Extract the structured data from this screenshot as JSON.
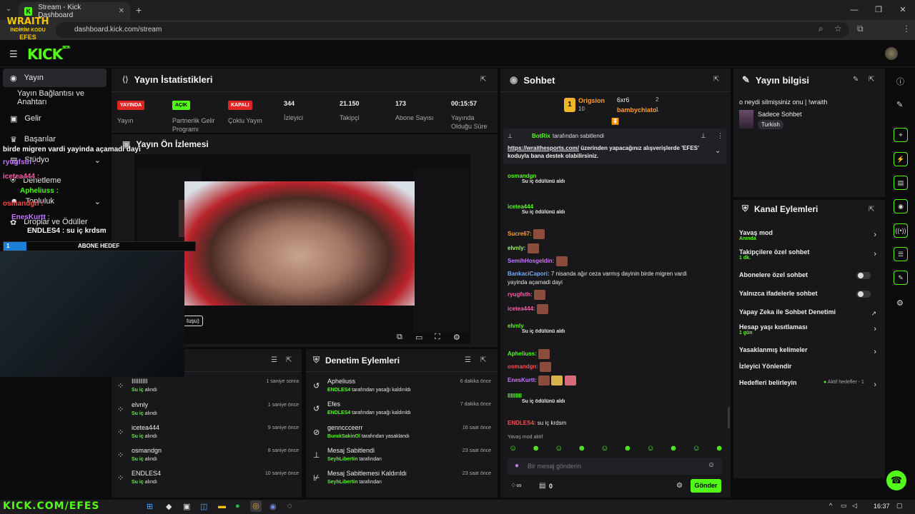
{
  "browser": {
    "tab_title": "Stream - Kick Dashboard",
    "url": "dashboard.kick.com/stream",
    "profile_initial": "E"
  },
  "brand": {
    "logo": "KICK",
    "beta": "BETA",
    "accent": "#53fc18"
  },
  "overlay": {
    "logo_line1": "WRAITH",
    "logo_line2": "İNDİRİM KODU",
    "logo_line3": "EFES",
    "chat_lines": [
      {
        "user": "birde migren vardi yayinda açamadi dayi",
        "color": "#ffffff"
      },
      {
        "user": "ryugfsth :",
        "color": "#c875ff"
      },
      {
        "user": "icetea444 :",
        "color": "#ff5ea8"
      },
      {
        "user": "Apheliuss :",
        "color": "#53fc18"
      },
      {
        "user": "osmandgn :",
        "color": "#ff4b4b"
      },
      {
        "user": "EnesKurtt :",
        "color": "#c875ff"
      },
      {
        "user": "ENDLES4 : su iç krdsm",
        "color": "#ffffff"
      }
    ],
    "goal_label": "ABONE HEDEF",
    "goal_value": "1",
    "goal_progress": 0.12,
    "bottom_banner": "KICK.COM/EFES"
  },
  "sidebar": {
    "items": [
      {
        "label": "Yayın",
        "icon": "broadcast-icon"
      },
      {
        "label": "Yayın Bağlantısı ve Anahtarı",
        "icon": ""
      },
      {
        "label": "Gelir",
        "icon": "wallet-icon"
      },
      {
        "label": "Başarılar",
        "icon": "trophy-icon"
      },
      {
        "label": "Stüdyo",
        "icon": "studio-icon"
      },
      {
        "label": "Denetleme",
        "icon": "shield-icon"
      },
      {
        "label": "Topluluk",
        "icon": "users-icon"
      },
      {
        "label": "Droplar ve Ödüller",
        "icon": "gift-icon"
      }
    ]
  },
  "stats": {
    "title": "Yayın İstatistikleri",
    "items": [
      {
        "badge": "YAYINDA",
        "badge_color": "#e02424",
        "label": "Yayın"
      },
      {
        "badge": "AÇIK",
        "badge_color": "#53fc18",
        "label": "Partnerlik Gelir Programı"
      },
      {
        "badge": "KAPALI",
        "badge_color": "#e02424",
        "label": "Çoklu Yayın"
      },
      {
        "value": "344",
        "label": "İzleyici"
      },
      {
        "value": "21.150",
        "label": "Takipçi"
      },
      {
        "value": "173",
        "label": "Abone Sayısı"
      },
      {
        "value": "00:15:57",
        "label": "Yayında Olduğu Süre"
      }
    ]
  },
  "preview": {
    "title": "Yayın Ön İzlemesi",
    "tooltip": "tuşu)"
  },
  "activity": {
    "rows": [
      {
        "name": "IIIIIIIII",
        "action": "Su iç",
        "status": "alındı",
        "time": "1 saniye sonra"
      },
      {
        "name": "elvnly",
        "action": "Su iç",
        "status": "alındı",
        "time": "1 saniye önce"
      },
      {
        "name": "icetea444",
        "action": "Su iç",
        "status": "alındı",
        "time": "9 saniye önce"
      },
      {
        "name": "osmandgn",
        "action": "Su iç",
        "status": "alındı",
        "time": "8 saniye önce"
      },
      {
        "name": "ENDLES4",
        "action": "Su iç",
        "status": "alındı",
        "time": "10 saniye önce"
      }
    ]
  },
  "moderation": {
    "title": "Denetim Eylemleri",
    "rows": [
      {
        "name": "Apheliuss",
        "by": "ENDLES4",
        "suffix": "tarafından yasağı kaldırıldı",
        "time": "6 dakika önce",
        "icon": "undo-icon"
      },
      {
        "name": "Efes",
        "by": "ENDLES4",
        "suffix": "tarafından yasağı kaldırıldı",
        "time": "7 dakika önce",
        "icon": "undo-icon"
      },
      {
        "name": "gennccceerr",
        "by": "BurakSakinOl",
        "suffix": "tarafından yasaklandı",
        "time": "16 saat önce",
        "icon": "ban-icon"
      },
      {
        "name": "Mesaj Sabitlendi",
        "by": "SeyhLibertin",
        "suffix": "tarafından",
        "time": "23 saat önce",
        "icon": "pin-icon"
      },
      {
        "name": "Mesaj Sabitlemesi Kaldırıldı",
        "by": "SeyhLibertin",
        "suffix": "tarafından",
        "time": "23 saat önce",
        "icon": "unpin-icon"
      }
    ]
  },
  "chat": {
    "title": "Sohbet",
    "top_gifters": [
      {
        "name": "Origsion",
        "amount": "10",
        "rank": "1"
      },
      {
        "name": "6xr6",
        "amount": "2"
      },
      {
        "name": "bambychiato",
        "amount": "1"
      }
    ],
    "pinned_by": "BotRix",
    "pinned_by_suffix": "tarafından sabitlendi",
    "pinned_link": "https://wraithesports.com/",
    "pinned_text": " üzerinden yapacağınız alışverişlerde 'EFES' koduyla bana destek olabilirsiniz.",
    "messages": [
      {
        "user": "osmandgn",
        "reward": "Su iç ödülünü aldı",
        "cls": "u-green"
      },
      {
        "user": "icetea444",
        "reward": "Su iç ödülünü aldı",
        "cls": "u-green"
      },
      {
        "user": "Sucre67:",
        "text": "",
        "cls": "u-orange"
      },
      {
        "user": "elvnly:",
        "text": "",
        "cls": "u-lime"
      },
      {
        "user": "SemihHosgeldin:",
        "text": "",
        "cls": "u-purple"
      },
      {
        "user": "BankaciCapori:",
        "text": "7 nisanda ağır ceza varmış dayinin birde migren vardi",
        "text2": "yayinda açamadi dayi",
        "cls": "u-blue"
      },
      {
        "user": "ryugfsth:",
        "text": "",
        "cls": "u-pink"
      },
      {
        "user": "icetea444:",
        "text": "",
        "cls": "u-pink"
      },
      {
        "user": "elvnly",
        "reward": "Su iç ödülünü aldı",
        "cls": "u-green"
      },
      {
        "user": "Apheliuss:",
        "text": "",
        "cls": "u-green"
      },
      {
        "user": "osmandgn:",
        "text": "",
        "cls": "u-red"
      },
      {
        "user": "EnesKurtt:",
        "text": "",
        "cls": "u-purple"
      },
      {
        "user": "IIIIIIIII",
        "reward": "Su iç ödülünü aldı",
        "cls": "u-green"
      },
      {
        "user": "ENDLES4:",
        "text": "su iç krdsm",
        "cls": "u-red"
      }
    ],
    "slow_mode": "Yavaş mod aktif",
    "input_placeholder": "Bir mesaj gönderin",
    "points": "0",
    "send_label": "Gönder"
  },
  "stream_info": {
    "title": "Yayın bilgisi",
    "stream_title": "o neydi silmişsiniz onu | !wraith",
    "category": "Sadece Sohbet",
    "language": "Turkish"
  },
  "channel_actions": {
    "title": "Kanal Eylemleri",
    "rows": [
      {
        "label": "Yavaş mod",
        "sub": "Anında",
        "control": "arrow"
      },
      {
        "label": "Takipçilere özel sohbet",
        "sub": "1 dk.",
        "control": "arrow"
      },
      {
        "label": "Abonelere özel sohbet",
        "sub": "",
        "control": "toggle"
      },
      {
        "label": "Yalnızca ifadelerle sohbet",
        "sub": "",
        "control": "toggle"
      },
      {
        "label": "Yapay Zeka ile Sohbet Denetimi",
        "sub": "",
        "control": "external"
      },
      {
        "label": "Hesap yaşı kısıtlaması",
        "sub": "1 gün",
        "control": "arrow"
      },
      {
        "label": "Yasaklanmış kelimeler",
        "sub": "",
        "control": "arrow"
      },
      {
        "label": "İzleyici Yönlendir",
        "sub": "",
        "control": "none"
      },
      {
        "label": "Hedefleri belirleyin",
        "sub": "",
        "control": "arrow",
        "extra": "Aktif hedefler - 1"
      }
    ]
  },
  "taskbar": {
    "time": "16:37"
  }
}
